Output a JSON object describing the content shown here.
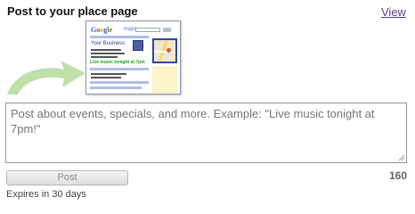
{
  "header": {
    "title": "Post to your place page",
    "view_link": "View"
  },
  "preview": {
    "logo_letters": [
      "G",
      "o",
      "o",
      "g",
      "l",
      "e"
    ],
    "logo_colors": [
      "#2d5ed6",
      "#d3302f",
      "#e8a60f",
      "#2d5ed6",
      "#2f9b3a",
      "#d3302f"
    ],
    "maps_label": "maps",
    "business_name": "Your Business",
    "highlight_text": "Live music tonight at 7pm"
  },
  "composer": {
    "placeholder": "Post about events, specials, and more. Example: \"Live music tonight at 7pm!\"",
    "value": "",
    "chars_remaining": "160"
  },
  "actions": {
    "post_label": "Post",
    "expires_text": "Expires in 30 days"
  },
  "colors": {
    "arrow": "#bfe0a8",
    "link": "#5b3b8c",
    "highlight": "#1d9e1d"
  }
}
